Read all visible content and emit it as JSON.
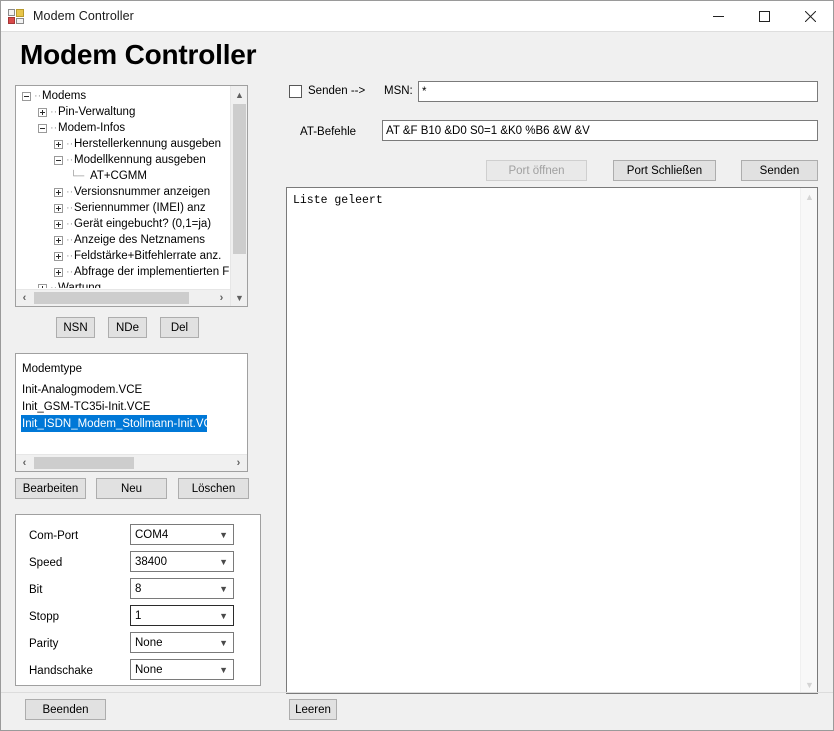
{
  "window": {
    "title": "Modem Controller",
    "icon": "winforms-app-icon",
    "minimize_label": "—",
    "maximize_label": "☐",
    "close_label": "✕"
  },
  "heading": "Modem Controller",
  "tree": {
    "nodes": [
      {
        "label": "Modems",
        "depth": 0,
        "toggle": "minus"
      },
      {
        "label": "Pin-Verwaltung",
        "depth": 1,
        "toggle": "plus"
      },
      {
        "label": "Modem-Infos",
        "depth": 1,
        "toggle": "minus"
      },
      {
        "label": "Herstellerkennung ausgeben",
        "depth": 2,
        "toggle": "plus"
      },
      {
        "label": "Modellkennung ausgeben",
        "depth": 2,
        "toggle": "minus"
      },
      {
        "label": "AT+CGMM",
        "depth": 3,
        "toggle": "leaf"
      },
      {
        "label": "Versionsnummer anzeigen",
        "depth": 2,
        "toggle": "plus"
      },
      {
        "label": "Seriennummer (IMEI) anz",
        "depth": 2,
        "toggle": "plus"
      },
      {
        "label": "Gerät eingebucht? (0,1=ja)",
        "depth": 2,
        "toggle": "plus"
      },
      {
        "label": "Anzeige des Netznamens",
        "depth": 2,
        "toggle": "plus"
      },
      {
        "label": "Feldstärke+Bitfehlerrate anz.",
        "depth": 2,
        "toggle": "plus"
      },
      {
        "label": "Abfrage der implementierten Fe",
        "depth": 2,
        "toggle": "plus"
      },
      {
        "label": "Wartung",
        "depth": 1,
        "toggle": "plus"
      }
    ]
  },
  "tree_buttons": {
    "nsn": "NSN",
    "nde": "NDe",
    "del": "Del"
  },
  "modemtype": {
    "header": "Modemtype",
    "items": [
      {
        "label": "Init-Analogmodem.VCE",
        "selected": false
      },
      {
        "label": "Init_GSM-TC35i-Init.VCE",
        "selected": false
      },
      {
        "label": "Init_ISDN_Modem_Stollmann-Init.VCE",
        "selected": true
      }
    ]
  },
  "list_buttons": {
    "edit": "Bearbeiten",
    "new": "Neu",
    "delete": "Löschen"
  },
  "settings": {
    "rows": [
      {
        "label": "Com-Port",
        "value": "COM4",
        "focused": false
      },
      {
        "label": "Speed",
        "value": "38400",
        "focused": false
      },
      {
        "label": "Bit",
        "value": "8",
        "focused": false
      },
      {
        "label": "Stopp",
        "value": "1",
        "focused": true
      },
      {
        "label": "Parity",
        "value": "None",
        "focused": false
      },
      {
        "label": "Handschake",
        "value": "None",
        "focused": false
      }
    ]
  },
  "send_area": {
    "checkbox_label": "Senden -->",
    "checkbox_checked": false,
    "msn_label": "MSN:",
    "msn_value": "*",
    "at_label": "AT-Befehle",
    "at_value": "AT &F B10 &D0 S0=1 &K0 %B6 &W &V"
  },
  "port_buttons": {
    "open": "Port öffnen",
    "open_enabled": false,
    "close": "Port Schließen",
    "send": "Senden"
  },
  "output": {
    "text": "Liste geleert"
  },
  "footer": {
    "quit": "Beenden",
    "clear": "Leeren"
  },
  "colors": {
    "selection": "#0078d7",
    "window_bg": "#f0f0f0",
    "field_bg": "#ffffff"
  }
}
